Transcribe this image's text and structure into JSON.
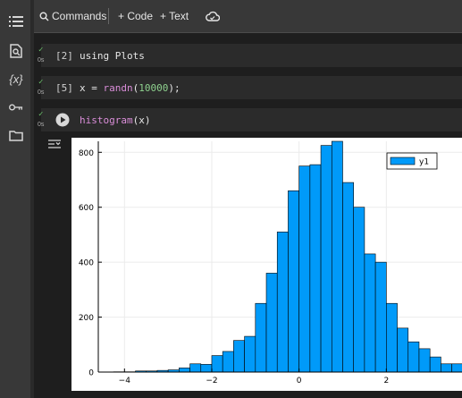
{
  "toolbar": {
    "commands_label": "Commands",
    "code_label": "+ Code",
    "text_label": "+ Text"
  },
  "sidebar": {
    "icons": [
      "toc-icon",
      "find-icon",
      "variables-icon",
      "secrets-icon",
      "folder-icon"
    ],
    "variables_glyph": "{x}"
  },
  "cells": [
    {
      "exec_num": "[2]",
      "time": "0s",
      "code": "using Plots"
    },
    {
      "exec_num": "[5]",
      "time": "0s",
      "code_var": "x = ",
      "code_fn": "randn",
      "code_open": "(",
      "code_num": "10000",
      "code_close": ");"
    },
    {
      "time": "0s",
      "code_fn": "histogram",
      "code_rest": "(x)"
    }
  ],
  "chart_data": {
    "type": "bar",
    "title": "",
    "xlabel": "",
    "ylabel": "",
    "xlim": [
      -4.6,
      4.0
    ],
    "ylim": [
      0,
      840
    ],
    "bin_width": 0.25,
    "bin_starts": [
      -4.25,
      -4.0,
      -3.75,
      -3.5,
      -3.25,
      -3.0,
      -2.75,
      -2.5,
      -2.25,
      -2.0,
      -1.75,
      -1.5,
      -1.25,
      -1.0,
      -0.75,
      -0.5,
      -0.25,
      0.0,
      0.25,
      0.5,
      0.75,
      1.0,
      1.25,
      1.5,
      1.75,
      2.0,
      2.25,
      2.5,
      2.75,
      3.0,
      3.25,
      3.5
    ],
    "values": [
      1,
      1,
      4,
      4,
      6,
      8,
      15,
      30,
      28,
      60,
      75,
      115,
      130,
      250,
      360,
      510,
      660,
      750,
      755,
      825,
      840,
      690,
      600,
      430,
      400,
      250,
      160,
      110,
      85,
      55,
      30,
      30,
      20
    ],
    "x_ticks": [
      -4,
      -2,
      0,
      2
    ],
    "x_tick_labels": [
      "−4",
      "−2",
      "0",
      "2"
    ],
    "y_ticks": [
      0,
      200,
      400,
      600,
      800
    ],
    "y_tick_labels": [
      "0",
      "200",
      "400",
      "600",
      "800"
    ],
    "legend": {
      "label": "y1",
      "placement": "top-right"
    },
    "bar_color": "#009af9",
    "grid": true
  }
}
